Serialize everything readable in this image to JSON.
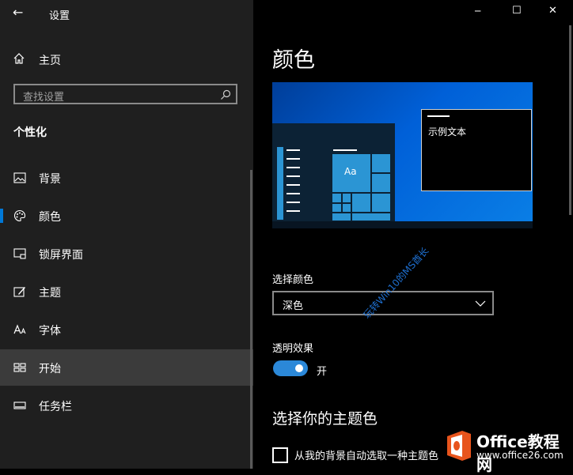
{
  "window": {
    "title": "设置",
    "back_glyph": "←"
  },
  "controls": {
    "minimize": "─",
    "maximize": "☐",
    "close": "✕"
  },
  "sidebar": {
    "home_label": "主页",
    "search_placeholder": "查找设置",
    "section_title": "个性化",
    "items": [
      {
        "label": "背景",
        "icon": "picture-icon",
        "state": "normal"
      },
      {
        "label": "颜色",
        "icon": "palette-icon",
        "state": "active"
      },
      {
        "label": "锁屏界面",
        "icon": "lock-screen-icon",
        "state": "normal"
      },
      {
        "label": "主题",
        "icon": "theme-brush-icon",
        "state": "normal"
      },
      {
        "label": "字体",
        "icon": "font-icon",
        "state": "normal"
      },
      {
        "label": "开始",
        "icon": "start-icon",
        "state": "hover"
      },
      {
        "label": "任务栏",
        "icon": "taskbar-icon",
        "state": "normal"
      }
    ]
  },
  "main": {
    "title": "颜色",
    "preview": {
      "sample_text": "示例文本",
      "tile_label": "Aa"
    },
    "color_mode": {
      "label": "选择颜色",
      "value": "深色"
    },
    "transparency": {
      "label": "透明效果",
      "state_label": "开",
      "on": true
    },
    "accent": {
      "title": "选择你的主题色",
      "auto_label": "从我的背景自动选取一种主题色",
      "checked": false
    }
  },
  "watermark": "玩转Win10的MS酋长",
  "logo": {
    "name": "Office教程网",
    "url": "www.office26.com"
  },
  "colors": {
    "accent": "#0078d7",
    "sidebar_bg": "#1f1f1f",
    "content_bg": "#000000",
    "toggle_on": "#2b88d8",
    "hover_bg": "#3b3b3b"
  }
}
